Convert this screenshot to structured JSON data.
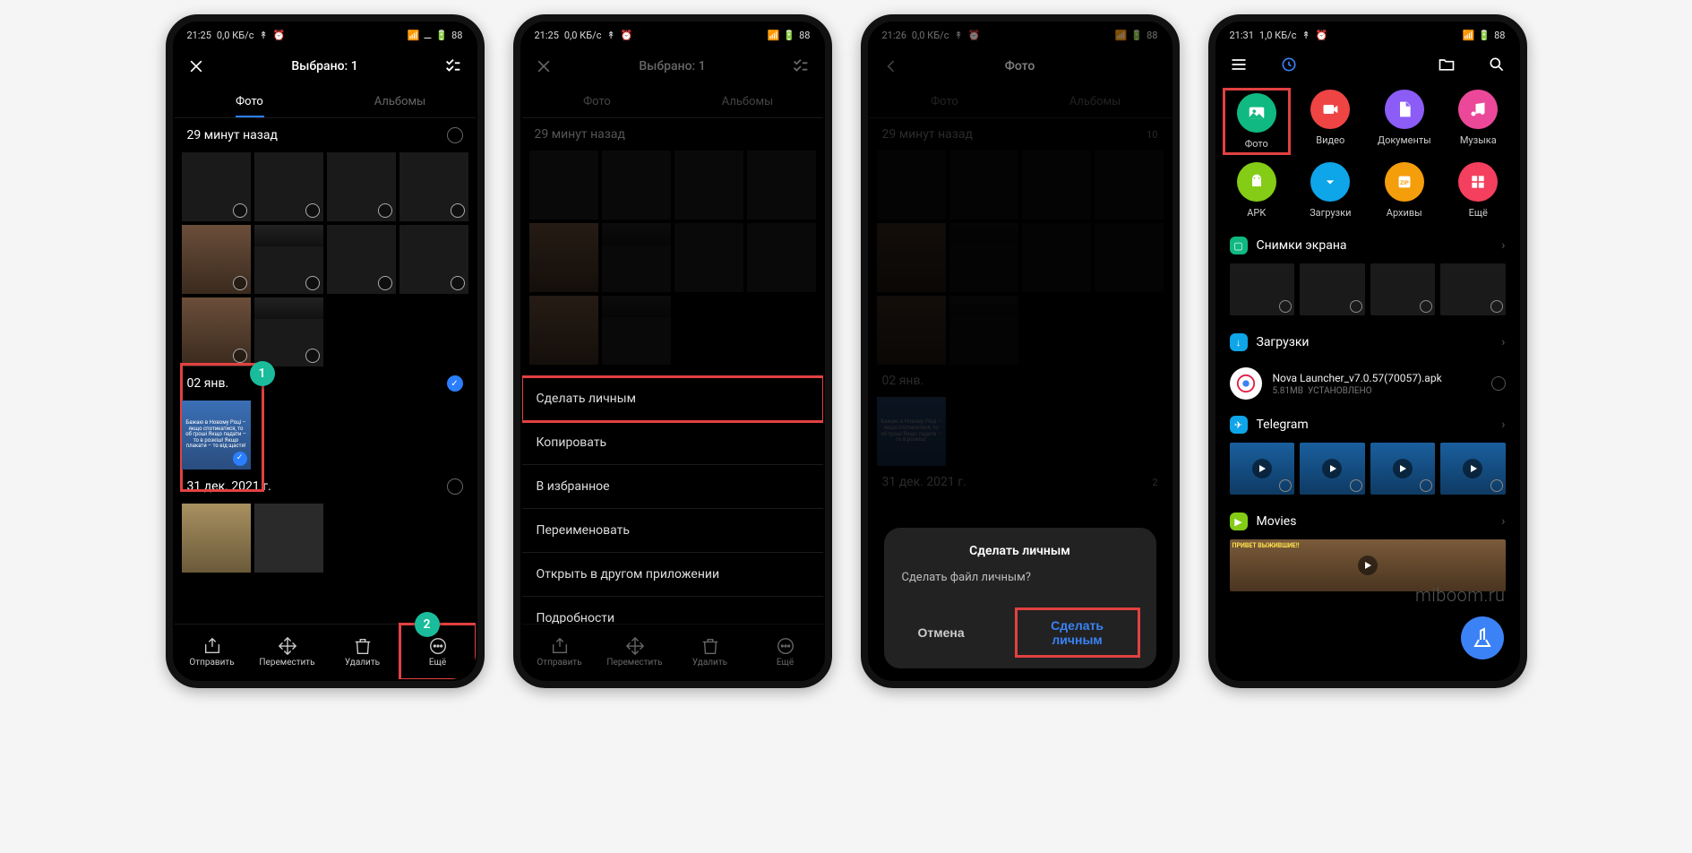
{
  "phones": [
    {
      "status": {
        "time": "21:25",
        "net": "0,0 КБ/с",
        "battery": "88"
      },
      "header_title": "Выбрано: 1",
      "tabs": {
        "photo": "Фото",
        "albums": "Альбомы"
      },
      "section1_title": "29 минут назад",
      "section2_title": "02 янв.",
      "section3_title": "31 дек. 2021 г.",
      "bottom": {
        "send": "Отправить",
        "move": "Переместить",
        "delete": "Удалить",
        "more": "Ещё"
      },
      "marker1": "1",
      "marker2": "2"
    },
    {
      "status": {
        "time": "21:25",
        "net": "0,0 КБ/с",
        "battery": "88"
      },
      "header_title": "Выбрано: 1",
      "tabs": {
        "photo": "Фото",
        "albums": "Альбомы"
      },
      "section1_title": "29 минут назад",
      "menu": {
        "private": "Сделать личным",
        "copy": "Копировать",
        "favorite": "В избранное",
        "rename": "Переименовать",
        "openin": "Открыть в другом приложении",
        "details": "Подробности"
      },
      "bottom": {
        "send": "Отправить",
        "move": "Переместить",
        "delete": "Удалить",
        "more": "Ещё"
      }
    },
    {
      "status": {
        "time": "21:26",
        "net": "0,0 КБ/с",
        "battery": "88"
      },
      "header_title": "Фото",
      "tabs": {
        "photo": "Фото",
        "albums": "Альбомы"
      },
      "section1_title": "29 минут назад",
      "section1_count": "10",
      "section2_title": "02 янв.",
      "section3_title": "31 дек. 2021 г.",
      "section3_count": "2",
      "dialog": {
        "title": "Сделать личным",
        "msg": "Сделать файл личным?",
        "cancel": "Отмена",
        "confirm": "Сделать личным"
      }
    },
    {
      "status": {
        "time": "21:31",
        "net": "1,0 КБ/с",
        "battery": "88"
      },
      "cats": {
        "photo": "Фото",
        "video": "Видео",
        "docs": "Документы",
        "music": "Музыка",
        "apk": "APK",
        "downloads": "Загрузки",
        "archives": "Архивы",
        "more": "Ещё"
      },
      "sections": {
        "screenshots": "Снимки экрана",
        "downloads": "Загрузки",
        "telegram": "Telegram",
        "movies": "Movies"
      },
      "file": {
        "name": "Nova Launcher_v7.0.57(70057).apk",
        "size": "5.81MB",
        "status": "УСТАНОВЛЕНО"
      },
      "watermark": "miboom.ru",
      "moviethumb": "ПРИВЕТ ВЫЖИВШИЕ!!"
    }
  ]
}
